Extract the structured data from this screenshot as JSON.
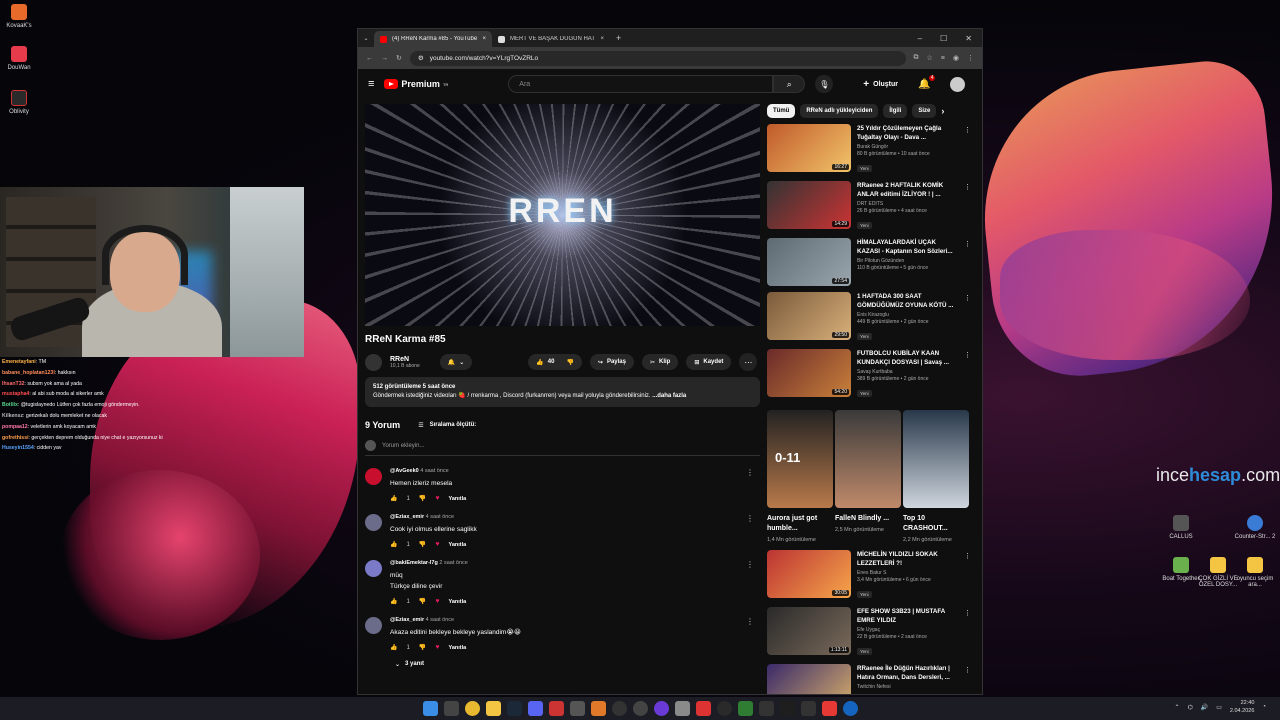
{
  "desktop": {
    "left_icons": [
      "KovaaK's",
      "DouWan",
      "Oblivity"
    ],
    "right_icons": [
      "CALLUS",
      "Counter-Str... 2",
      "Boat Together",
      "ÇOK GİZLİ VE ÖZEL DOSY...",
      "oyuncu seçim ara..."
    ],
    "watermark_a": "ince",
    "watermark_b": "hesap",
    "watermark_c": ".com"
  },
  "chat": [
    {
      "user": "Emenetayfani",
      "msg": ": TM",
      "color": "#ffb347"
    },
    {
      "user": "babane_hoplatan123l",
      "msg": ": hakksın",
      "color": "#ff8c5a"
    },
    {
      "user": "IhsanT32",
      "msg": ": subsm yok ama al yada",
      "color": "#ff6b6b"
    },
    {
      "user": "mustapha4",
      "msg": ": al abi sub moda al sikerler amk",
      "color": "#ff4d4d"
    },
    {
      "user": "Botlilx",
      "msg": ": @tugislaynedo Lütfen çok fazla emoji göndermeyin.",
      "color": "#59d98e"
    },
    {
      "user": "Kilkensz",
      "msg": ": gerizekalı dolu memleket ne olacak",
      "color": "#bbbbbb"
    },
    {
      "user": "pompaa12",
      "msg": ": veletlerin amk koyacam amk",
      "color": "#ff77aa"
    },
    {
      "user": "gofrethissi",
      "msg": ": gerçekten deprem olduğunda niye chat e yazıyorsunuz ki",
      "color": "#ffa04d"
    },
    {
      "user": "Huseyin1554",
      "msg": ": cidden yav",
      "color": "#5aa7ff"
    }
  ],
  "browser": {
    "tabs": [
      {
        "title": "(4) RReN Karma #85 - YouTube",
        "active": true
      },
      {
        "title": "MERT VE BAŞAK DÜĞÜN HATIR",
        "active": false
      }
    ],
    "url": "youtube.com/watch?v=YLrgTOvZRLo"
  },
  "yt": {
    "brand": "Premium",
    "brand_sup": "TR",
    "search_placeholder": "Ara",
    "create_label": "Oluştur",
    "notif_count": "4"
  },
  "video": {
    "player_text": "RREN",
    "title": "RReN Karma #85",
    "channel": "RReN",
    "subscribers": "10,1 B abone",
    "likes": "40",
    "share": "Paylaş",
    "clip": "Klip",
    "save": "Kaydet",
    "views_meta": "512 görüntüleme  5 saat önce",
    "description": "Göndermek istediğiniz videoları 🍓 / rrenkarma , Discord (furkanrren) veya mail yoluyla gönderebilirsiniz.",
    "more": "...daha fazla"
  },
  "comments": {
    "count": "9 Yorum",
    "sort": "Sıralama ölçütü:",
    "add_placeholder": "Yorum ekleyin...",
    "reply_label": "Yanıtla",
    "items": [
      {
        "author": "@AvGeek0",
        "when": "4 saat önce",
        "lines": [
          "Hemen izleriz mesela"
        ],
        "likes": "1",
        "color": "#c8102e"
      },
      {
        "author": "@Eziax_emir",
        "when": "4 saat önce",
        "lines": [
          "Cook iyi olmus ellerine saglikk"
        ],
        "likes": "1",
        "color": "#6b6b8a"
      },
      {
        "author": "@bakiEmektar-l7g",
        "when": "2 saat önce",
        "lines": [
          "müq",
          "Türkçe diline çevir"
        ],
        "likes": "1",
        "color": "#7a7ac8"
      },
      {
        "author": "@Eziax_emir",
        "when": "4 saat önce",
        "lines": [
          "Akaza editini bekleye bekleye yaslandim😭😀"
        ],
        "likes": "1",
        "color": "#6b6b8a"
      }
    ],
    "replies_label": "3 yanıt"
  },
  "sidebar": {
    "chips": [
      "Tümü",
      "RReN adlı yükleyiciden",
      "İlgili",
      "Size"
    ],
    "recs": [
      {
        "title": "25 Yıldır Çözülemeyen Çağla Tuğaltay Olayı - Dava ...",
        "channel": "Burak Güngör",
        "meta": "80 B görüntüleme • 10 saat önce",
        "dur": "16:27",
        "new": "Yeni",
        "c1": "#c05a2a",
        "c2": "#f2c46a"
      },
      {
        "title": "RRaenee 2 HAFTALIK KOMİK ANLAR editimi İZLİYOR ! | ...",
        "channel": "DRT EDITS",
        "meta": "26 B görüntüleme • 4 saat önce",
        "dur": "14:29",
        "new": "Yeni",
        "c1": "#333",
        "c2": "#c33"
      },
      {
        "title": "HİMALAYALARDAKİ UÇAK KAZASI - Kaptanın Son Sözleri...",
        "channel": "Bir Pilotun Gözünden",
        "meta": "110 B görüntüleme • 5 gün önce",
        "dur": "27:54",
        "new": "",
        "c1": "#5e6a72",
        "c2": "#9aa6ad"
      },
      {
        "title": "1 HAFTADA 300 SAAT GÖMDÜĞÜMÜZ OYUNA KÖTÜ ...",
        "channel": "Enis Kirazoglu",
        "meta": "449 B görüntüleme • 2 gün önce",
        "dur": "29:50",
        "new": "Yeni",
        "c1": "#7a5a3a",
        "c2": "#d9b07a"
      },
      {
        "title": "FUTBOLCU KUBİLAY KAAN KUNDAKÇI DOSYASI | Savaş ...",
        "channel": "Savaş Kurtbaba",
        "meta": "389 B görüntüleme • 2 gün önce",
        "dur": "54:20",
        "new": "Yeni",
        "c1": "#6a2a2a",
        "c2": "#c9803a"
      }
    ],
    "shorts": [
      {
        "title": "Aurora just got humble...",
        "views": "1,4 Mn görüntüleme",
        "overlay": "0-11",
        "c1": "#222",
        "c2": "#b97a4a"
      },
      {
        "title": "FalleN Blindly ...",
        "views": "2,5 Mn görüntüleme",
        "overlay": "",
        "c1": "#3a3a3a",
        "c2": "#c08a6a"
      },
      {
        "title": "Top 10 CRASHOUT...",
        "views": "2,2 Mn görüntüleme",
        "overlay": "",
        "c1": "#28384a",
        "c2": "#cfd6de"
      }
    ],
    "recs2": [
      {
        "title": "MİCHELİN YILDIZLI SOKAK LEZZETLERİ ?!",
        "channel": "Enes Batur S",
        "meta": "3,4 Mn görüntüleme • 6 gün önce",
        "dur": "30:05",
        "new": "Yeni",
        "c1": "#b33",
        "c2": "#f6a64a"
      },
      {
        "title": "EFE SHOW S3B23 | MUSTAFA EMRE YILDIZ",
        "channel": "Efe Uygaç",
        "meta": "22 B görüntüleme • 2 saat önce",
        "dur": "1:13:11",
        "new": "Yeni",
        "c1": "#2a2a2a",
        "c2": "#7a6a5a"
      },
      {
        "title": "RRaenee İle Düğün Hazırlıkları | Hatıra Ormanı, Dans Dersleri, ...",
        "channel": "Twitchin Nefesi",
        "meta": "",
        "dur": "",
        "new": "",
        "c1": "#3a2a6a",
        "c2": "#d9b06a"
      }
    ]
  },
  "taskbar": {
    "time": "22:40",
    "date": "2.04.2026"
  }
}
